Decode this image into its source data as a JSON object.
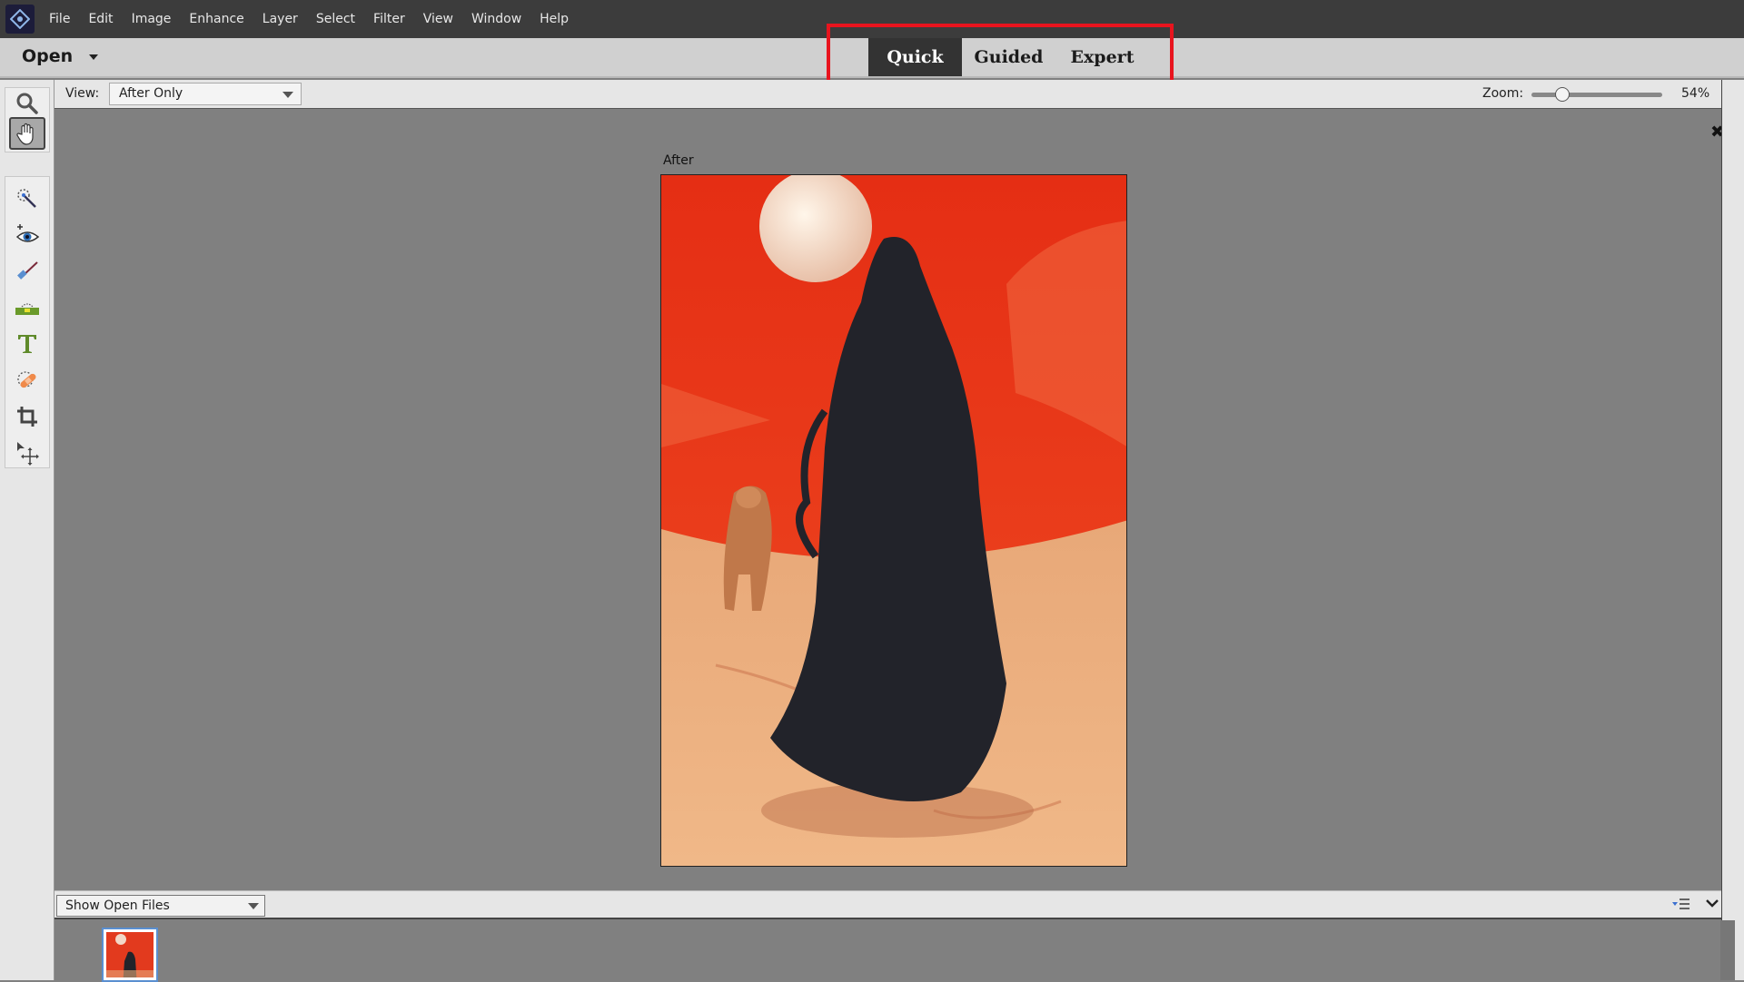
{
  "menubar": {
    "logo_icon": "photoshop-elements-logo-icon",
    "items": [
      "File",
      "Edit",
      "Image",
      "Enhance",
      "Layer",
      "Select",
      "Filter",
      "View",
      "Window",
      "Help"
    ]
  },
  "modebar": {
    "open_label": "Open",
    "tabs": [
      {
        "label": "Quick",
        "active": true
      },
      {
        "label": "Guided",
        "active": false
      },
      {
        "label": "Expert",
        "active": false
      }
    ],
    "highlight_color": "#e8141e"
  },
  "options": {
    "view_label": "View:",
    "view_value": "After Only",
    "zoom_label": "Zoom:",
    "zoom_value": "54%",
    "zoom_fraction": 0.2
  },
  "toolbar": {
    "tools": [
      {
        "name": "zoom-tool",
        "icon": "magnifier-icon",
        "active": false
      },
      {
        "name": "hand-tool",
        "icon": "hand-icon",
        "active": true
      },
      {
        "name": "quick-selection-tool",
        "icon": "quick-selection-icon",
        "active": false
      },
      {
        "name": "red-eye-tool",
        "icon": "eye-icon",
        "active": false
      },
      {
        "name": "whiten-teeth-tool",
        "icon": "toothbrush-icon",
        "active": false
      },
      {
        "name": "straighten-tool",
        "icon": "level-icon",
        "active": false
      },
      {
        "name": "type-tool",
        "icon": "type-icon",
        "active": false
      },
      {
        "name": "spot-healing-tool",
        "icon": "bandage-icon",
        "active": false
      },
      {
        "name": "crop-tool",
        "icon": "crop-icon",
        "active": false
      },
      {
        "name": "move-tool",
        "icon": "move-icon",
        "active": false
      }
    ]
  },
  "canvas": {
    "preview_label": "After",
    "close_icon": "close-icon"
  },
  "photo_bin": {
    "select_value": "Show Open Files",
    "options_icon": "bin-options-icon",
    "collapse_icon": "chevron-down-icon"
  }
}
